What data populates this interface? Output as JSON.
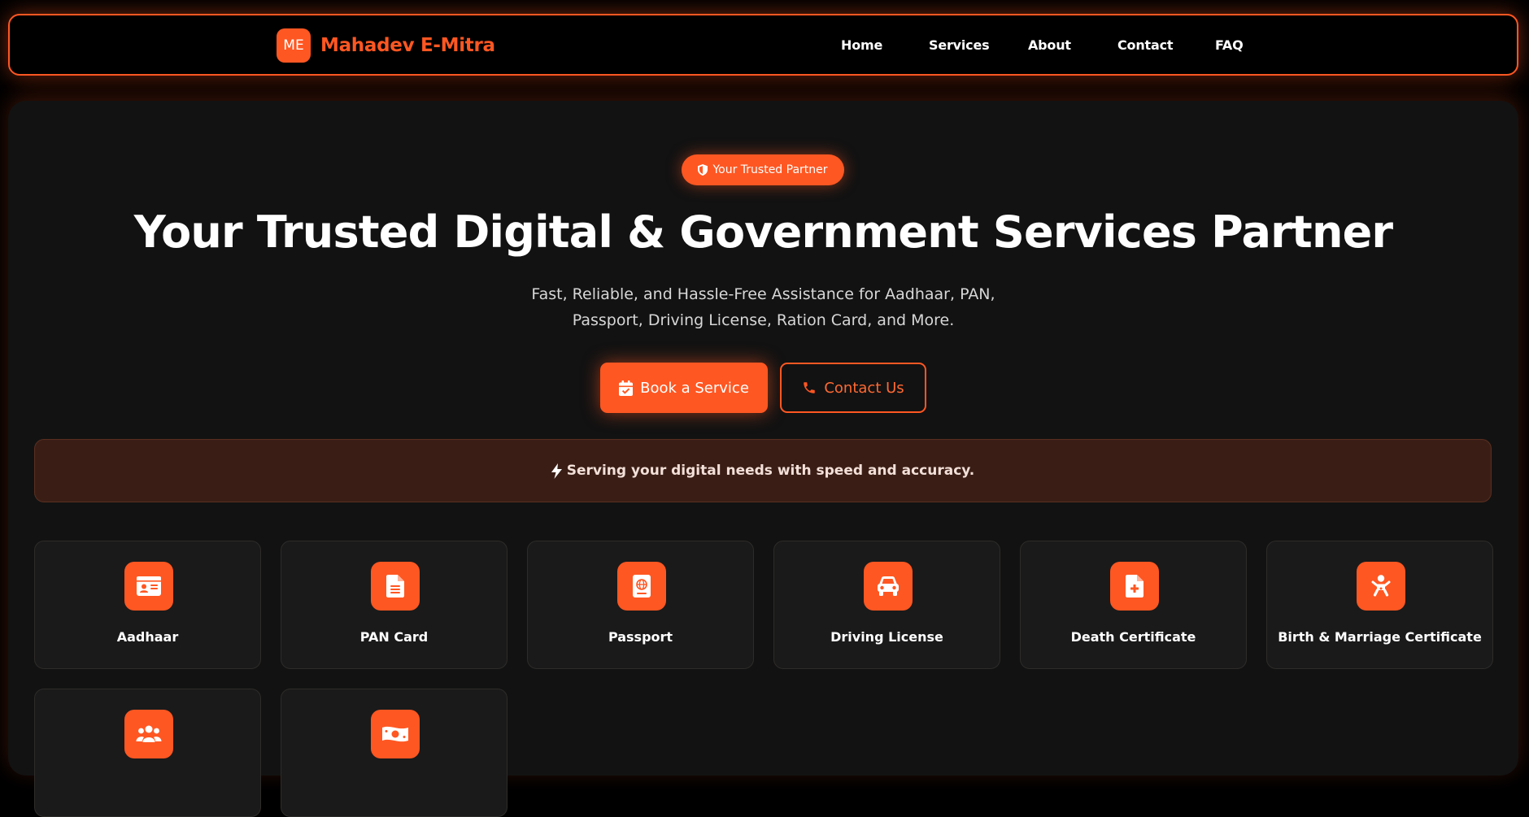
{
  "brand": {
    "logo_text": "ME",
    "name": "Mahadev E-Mitra"
  },
  "nav": {
    "items": [
      "Home",
      "Services",
      "About",
      "Contact",
      "FAQ"
    ]
  },
  "hero": {
    "badge": "Your Trusted Partner",
    "title": "Your Trusted Digital & Government Services Partner",
    "subtitle_line1": "Fast, Reliable, and Hassle-Free Assistance for Aadhaar, PAN,",
    "subtitle_line2": "Passport, Driving License, Ration Card, and More.",
    "primary_button": "Book a Service",
    "secondary_button": "Contact Us"
  },
  "banner": {
    "text": "Serving your digital needs with speed and accuracy."
  },
  "services": [
    {
      "label": "Aadhaar",
      "icon": "id-card-icon"
    },
    {
      "label": "PAN Card",
      "icon": "document-icon"
    },
    {
      "label": "Passport",
      "icon": "passport-icon"
    },
    {
      "label": "Driving License",
      "icon": "car-icon"
    },
    {
      "label": "Death Certificate",
      "icon": "file-medical-icon"
    },
    {
      "label": "Birth & Marriage Certificate",
      "icon": "baby-icon"
    },
    {
      "label": "",
      "icon": "users-icon"
    },
    {
      "label": "",
      "icon": "money-bill-icon"
    }
  ],
  "colors": {
    "accent": "#ff5722",
    "background": "#000000",
    "panel": "#121212",
    "card": "#1a1a1a",
    "banner": "#3a1e16"
  }
}
